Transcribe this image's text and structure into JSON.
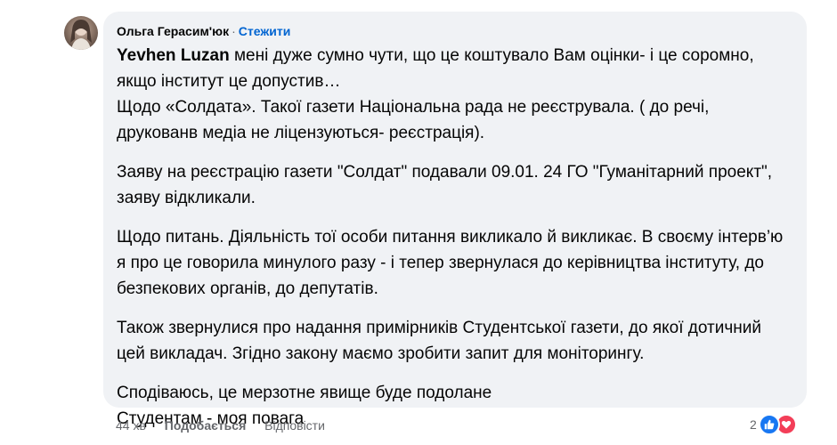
{
  "comment": {
    "author": "Ольга Герасим'юк",
    "separator": "·",
    "follow_label": "Стежити",
    "mention": "Yevhen Luzan",
    "first_line_rest": " мені дуже сумно чути, що це коштувало Вам оцінки- і це соромно, якщо інститут це допустив…",
    "p1_line2": "Щодо «Солдата». Такої газети Національна рада не реєструвала. ( до речі, друкованв медіа не ліцензуються- реєстрація).",
    "p2": "Заяву на реєстрацію газети \"Солдат\" подавали 09.01. 24 ГО \"Гуманітарний проект\", заяву відкликали.",
    "p3": "Щодо питань. Діяльність тої особи питання викликало й викликає. В своєму інтерв’ю я про це говорила минулого разу - і тепер звернулася до керівництва інституту, до безпекових органів, до депутатів.",
    "p4": "Також звернулися про надання примірників Студентської газети, до якої дотичний цей викладач. Згідно закону маємо зробити запит для моніторингу.",
    "p5_line1": "Сподіваюсь, це мерзотне явище буде подолане",
    "p5_line2": "Студентам - моя повага"
  },
  "actions": {
    "time": "44 хв",
    "like_label": "Подобається",
    "reply_label": "Відповісти"
  },
  "reactions": {
    "count": "2",
    "types": [
      "like-icon",
      "love-icon"
    ],
    "like_color": "#1877f2",
    "love_color": "#f33e58"
  },
  "colors": {
    "bubble": "#f0f2f5",
    "link": "#0064d1",
    "secondary_text": "#65676b"
  }
}
